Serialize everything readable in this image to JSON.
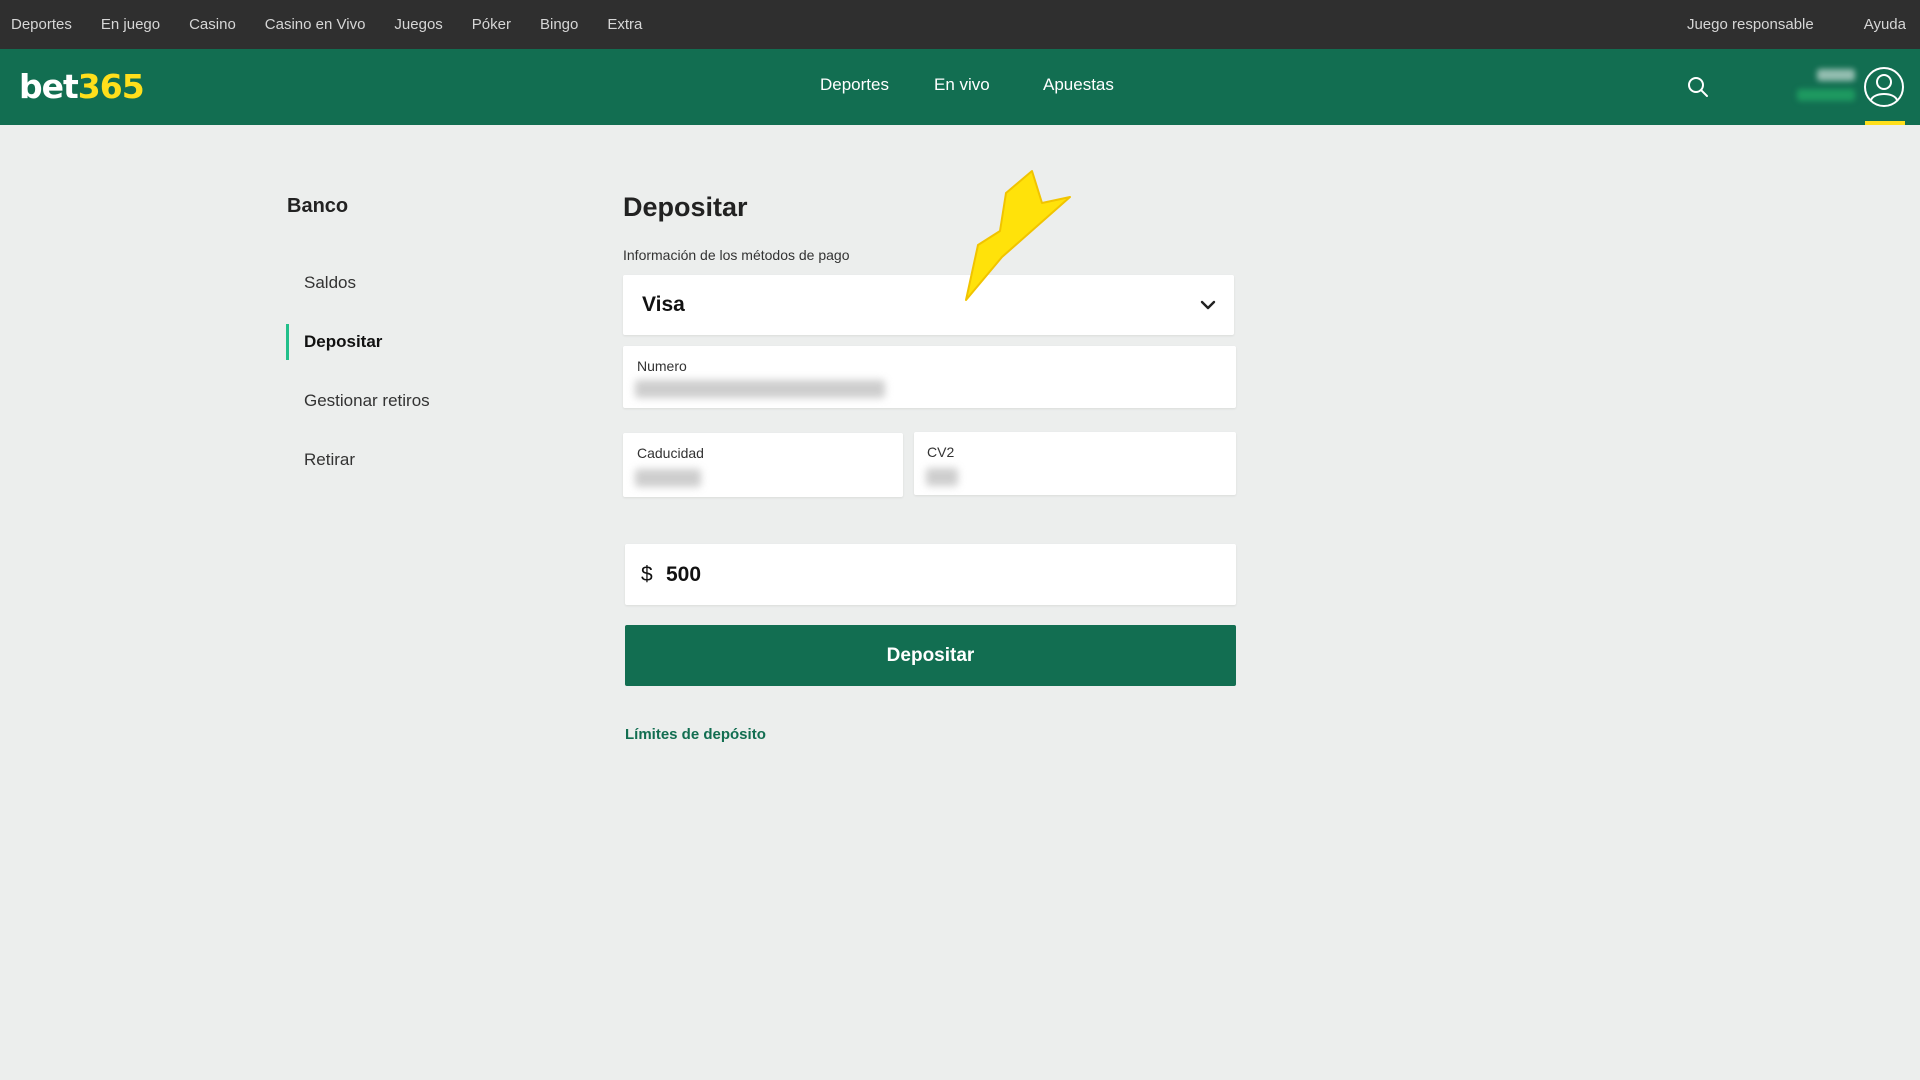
{
  "topbar": {
    "left_links": [
      "Deportes",
      "En juego",
      "Casino",
      "Casino en Vivo",
      "Juegos",
      "Póker",
      "Bingo",
      "Extra"
    ],
    "right_links": [
      "Juego responsable",
      "Ayuda"
    ]
  },
  "header": {
    "logo_part1": "bet",
    "logo_part2": "365",
    "nav": [
      "Deportes",
      "En vivo",
      "Apuestas"
    ],
    "icons": {
      "search": "search-icon",
      "user": "user-account-icon"
    },
    "colors": {
      "brand_green": "#126e51",
      "brand_yellow": "#ffdf1b",
      "topbar": "#2f2f2f",
      "active_marker": "#22bf8a"
    }
  },
  "sidebar": {
    "title": "Banco",
    "items": [
      {
        "label": "Saldos",
        "active": false
      },
      {
        "label": "Depositar",
        "active": true
      },
      {
        "label": "Gestionar retiros",
        "active": false
      },
      {
        "label": "Retirar",
        "active": false
      }
    ]
  },
  "deposit": {
    "title": "Depositar",
    "payment_info_label": "Información de los métodos de pago",
    "payment_method": "Visa",
    "card_number_label": "Numero",
    "expiry_label": "Caducidad",
    "cvv_label": "CV2",
    "currency_symbol": "$",
    "amount": "500",
    "submit_label": "Depositar",
    "limits_link": "Límites de depósito"
  }
}
